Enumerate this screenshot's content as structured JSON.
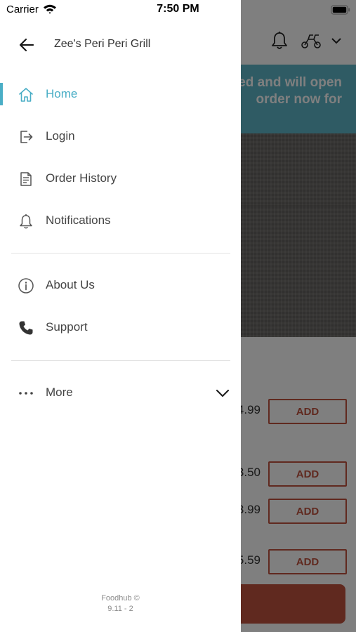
{
  "status_bar": {
    "carrier": "Carrier",
    "time": "7:50 PM"
  },
  "drawer": {
    "restaurant_name": "Zee's Peri Peri Grill",
    "accent_color": "#4aaec6",
    "primary_items": [
      {
        "label": "Home",
        "icon": "home-icon",
        "active": true
      },
      {
        "label": "Login",
        "icon": "login-icon",
        "active": false
      },
      {
        "label": "Order History",
        "icon": "receipt-icon",
        "active": false
      },
      {
        "label": "Notifications",
        "icon": "bell-icon",
        "active": false
      }
    ],
    "secondary_items": [
      {
        "label": "About Us",
        "icon": "info-icon"
      },
      {
        "label": "Support",
        "icon": "phone-icon"
      }
    ],
    "more": {
      "label": "More",
      "icon": "ellipsis-icon"
    },
    "footer": {
      "brand": "Foodhub ©",
      "version": "9.11 - 2"
    }
  },
  "background": {
    "banner": {
      "line1": "ed and will open",
      "line2": "order now for",
      "color": "#5fb6c9"
    },
    "menu_items": [
      {
        "price": "4.99",
        "add_label": "ADD"
      },
      {
        "price": "3.50",
        "add_label": "ADD"
      },
      {
        "price": "3.99",
        "add_label": "ADD"
      },
      {
        "price": "5.59",
        "add_label": "ADD"
      }
    ],
    "brand_color": "#c0533f"
  }
}
